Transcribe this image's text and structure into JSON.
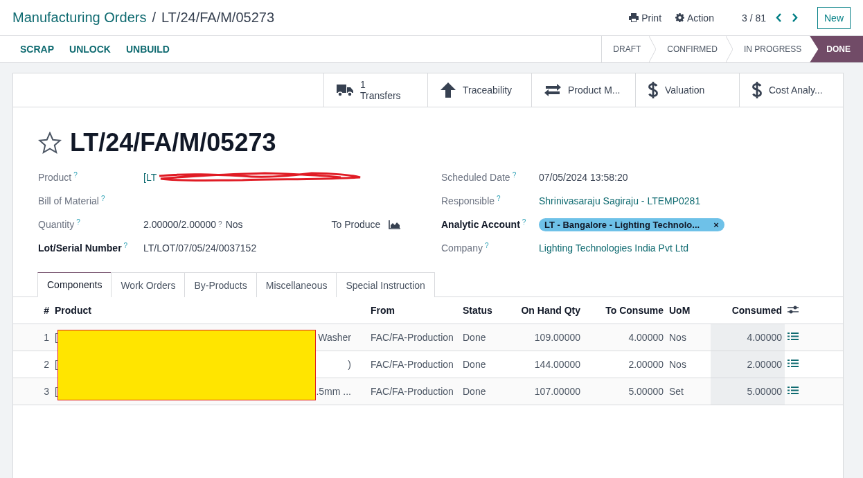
{
  "breadcrumb": {
    "parent": "Manufacturing Orders",
    "separator": "/",
    "current": "LT/24/FA/M/05273"
  },
  "top_actions": {
    "print": "Print",
    "action": "Action",
    "pager": "3 / 81",
    "new": "New"
  },
  "action_buttons": [
    "SCRAP",
    "UNLOCK",
    "UNBUILD"
  ],
  "status_steps": [
    {
      "label": "DRAFT",
      "selected": false
    },
    {
      "label": "CONFIRMED",
      "selected": false
    },
    {
      "label": "IN PROGRESS",
      "selected": false
    },
    {
      "label": "DONE",
      "selected": true
    }
  ],
  "smart_buttons": [
    {
      "kind": "truck",
      "count": "1",
      "label": "Transfers"
    },
    {
      "kind": "arrow-up",
      "label": "Traceability"
    },
    {
      "kind": "swap",
      "label": "Product M..."
    },
    {
      "kind": "dollar",
      "label": "Valuation"
    },
    {
      "kind": "dollar",
      "label": "Cost Analy..."
    }
  ],
  "title": {
    "starred": false,
    "text": "LT/24/FA/M/05273"
  },
  "left_fields": [
    {
      "label": "Product",
      "help": "?",
      "bold": false,
      "kind": "redacted-link",
      "value": "[LT"
    },
    {
      "label": "Bill of Material",
      "help": "?",
      "bold": false,
      "kind": "empty"
    },
    {
      "label": "Quantity",
      "help": "?",
      "bold": false,
      "kind": "quantity",
      "value": "2.00000/2.00000",
      "value_help": "?",
      "unit": "Nos",
      "extra_label": "To Produce"
    },
    {
      "label": "Lot/Serial Number",
      "help": "?",
      "bold": true,
      "kind": "text",
      "value": "LT/LOT/07/05/24/0037152"
    }
  ],
  "right_fields": [
    {
      "label": "Scheduled Date",
      "help": "?",
      "bold": false,
      "kind": "text",
      "value": "07/05/2024 13:58:20"
    },
    {
      "label": "Responsible",
      "help": "?",
      "bold": false,
      "kind": "link",
      "value": "Shrinivasaraju Sagiraju - LTEMP0281"
    },
    {
      "label": "Analytic Account",
      "help": "?",
      "bold": true,
      "kind": "tag",
      "value": "LT - Bangalore - Lighting Technolo...",
      "remove": "×"
    },
    {
      "label": "Company",
      "help": "?",
      "bold": false,
      "kind": "link",
      "value": "Lighting Technologies India Pvt Ltd"
    }
  ],
  "tabs": [
    {
      "label": "Components",
      "selected": true
    },
    {
      "label": "Work Orders",
      "selected": false
    },
    {
      "label": "By-Products",
      "selected": false
    },
    {
      "label": "Miscellaneous",
      "selected": false
    },
    {
      "label": "Special Instruction",
      "selected": false
    }
  ],
  "table": {
    "columns": [
      "#",
      "Product",
      "From",
      "Status",
      "On Hand Qty",
      "To Consume",
      "UoM",
      "Consumed"
    ],
    "rows": [
      {
        "index": "1",
        "product_start": "[",
        "product_end": "Washer",
        "from": "FAC/FA-Production",
        "status": "Done",
        "on_hand": "109.00000",
        "to_consume": "4.00000",
        "uom": "Nos",
        "consumed": "4.00000"
      },
      {
        "index": "2",
        "product_start": "[",
        "product_end": ")",
        "from": "FAC/FA-Production",
        "status": "Done",
        "on_hand": "144.00000",
        "to_consume": "2.00000",
        "uom": "Nos",
        "consumed": "2.00000"
      },
      {
        "index": "3",
        "product_start": "[",
        "product_end": ".5mm ...",
        "from": "FAC/FA-Production",
        "status": "Done",
        "on_hand": "107.00000",
        "to_consume": "5.00000",
        "uom": "Set",
        "consumed": "5.00000"
      }
    ]
  }
}
